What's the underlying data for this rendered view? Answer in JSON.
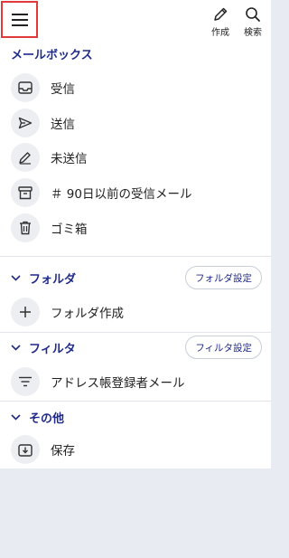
{
  "topbar": {
    "compose_label": "作成",
    "search_label": "検索"
  },
  "mailbox": {
    "heading": "メールボックス",
    "items": [
      {
        "label": "受信",
        "icon": "inbox-icon"
      },
      {
        "label": "送信",
        "icon": "send-icon"
      },
      {
        "label": "未送信",
        "icon": "pencil-icon"
      },
      {
        "label": "＃ 90日以前の受信メール",
        "icon": "archive-icon"
      },
      {
        "label": "ゴミ箱",
        "icon": "trash-icon"
      }
    ]
  },
  "folders": {
    "heading": "フォルダ",
    "settings_label": "フォルダ設定",
    "create_label": "フォルダ作成"
  },
  "filters": {
    "heading": "フィルタ",
    "settings_label": "フィルタ設定",
    "item_label": "アドレス帳登録者メール"
  },
  "other": {
    "heading": "その他",
    "save_label": "保存"
  },
  "colors": {
    "accent": "#1f2a8a",
    "highlight_border": "#e03a3a",
    "icon_circle": "#eceef2",
    "footer_background": "#e9ebf3"
  }
}
